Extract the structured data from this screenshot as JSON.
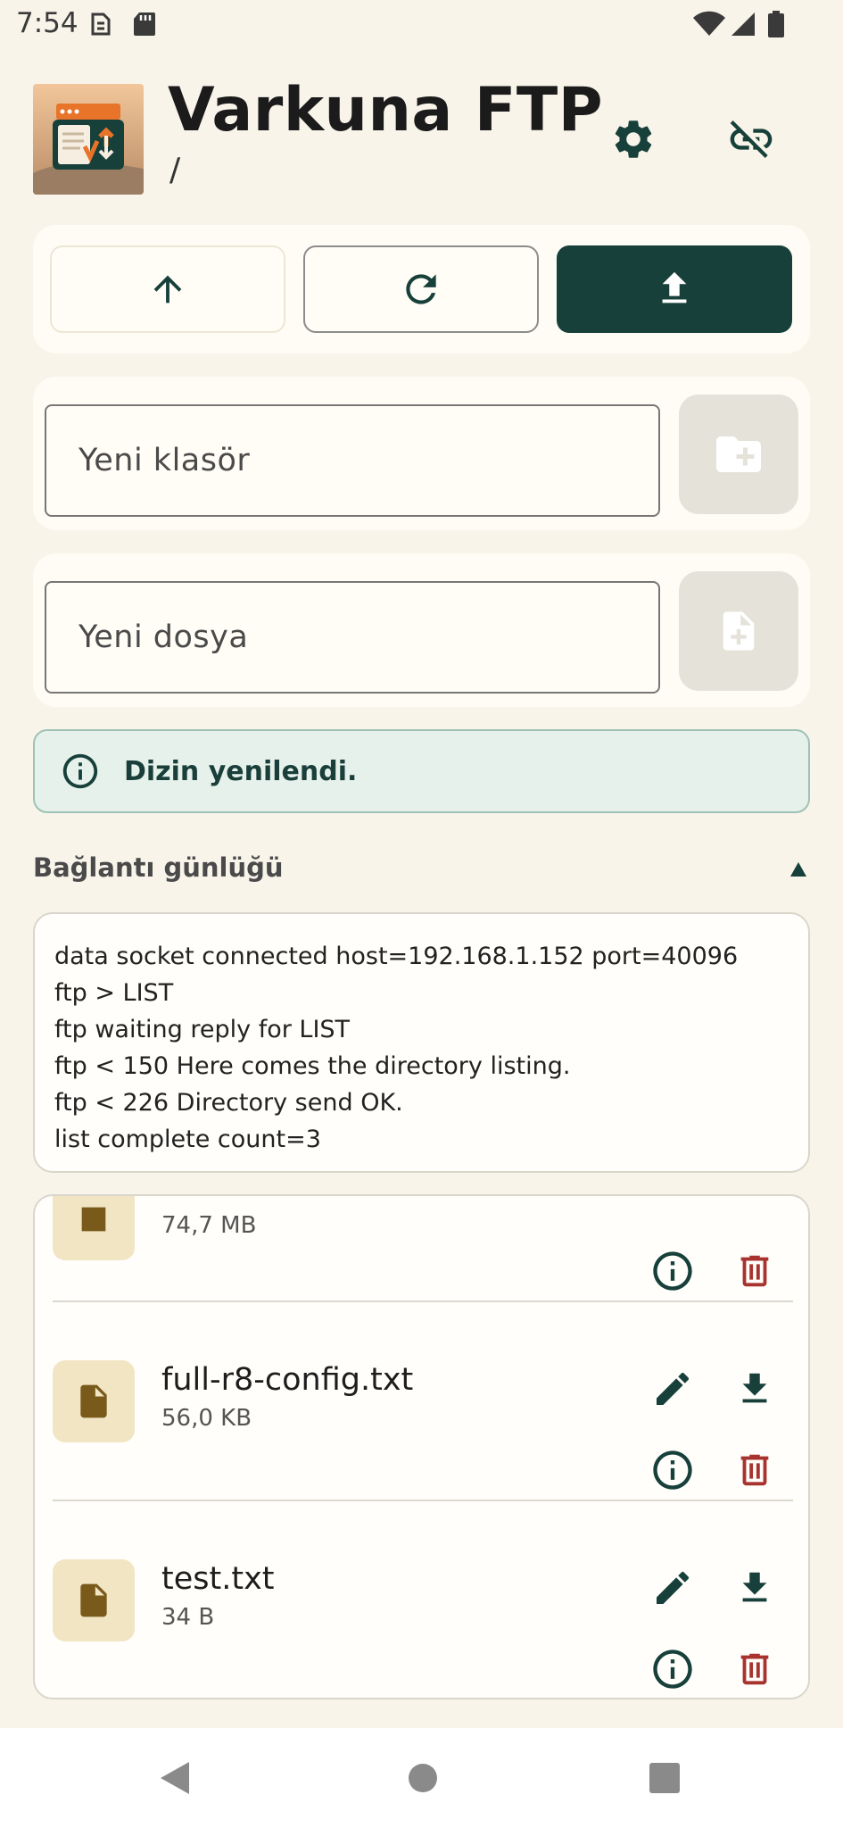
{
  "status_bar": {
    "time": "7:54"
  },
  "header": {
    "title": "Varkuna FTP",
    "path": "/"
  },
  "new_folder": {
    "placeholder": "Yeni klasör"
  },
  "new_file": {
    "placeholder": "Yeni dosya"
  },
  "banner": {
    "message": "Dizin yenilendi."
  },
  "log": {
    "title": "Bağlantı günlüğü",
    "lines": [
      "data socket connected host=192.168.1.152 port=40096",
      "ftp > LIST",
      "ftp waiting reply for LIST",
      "ftp < 150 Here comes the directory listing.",
      "ftp < 226 Directory send OK.",
      "list complete count=3"
    ]
  },
  "files": [
    {
      "name": "",
      "size": "74,7 MB"
    },
    {
      "name": "full-r8-config.txt",
      "size": "56,0 KB"
    },
    {
      "name": "test.txt",
      "size": "34 B"
    }
  ],
  "colors": {
    "accent": "#17403a",
    "danger": "#a8332e",
    "file_icon": "#7a5a1a",
    "background": "#f8f4ea"
  }
}
